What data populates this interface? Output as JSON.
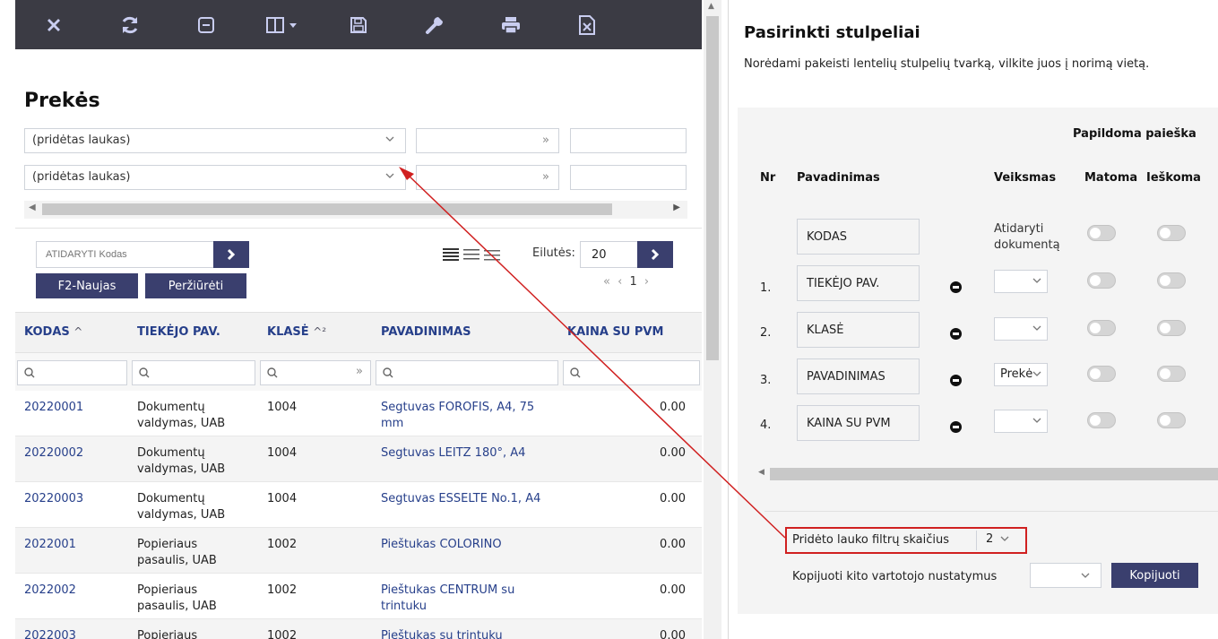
{
  "toolbar": {
    "icons": [
      "close-icon",
      "refresh-icon",
      "collapse-icon",
      "columns-dropdown-icon",
      "save-icon",
      "settings-wrench-icon",
      "print-icon",
      "excel-export-icon"
    ]
  },
  "left": {
    "title": "Prekės",
    "filters": [
      {
        "field": "(pridėtas laukas)",
        "value": ""
      },
      {
        "field": "(pridėtas laukas)",
        "value": ""
      }
    ],
    "open_placeholder": "ATIDARYTI Kodas",
    "btn_new": "F2-Naujas",
    "btn_view": "Peržiūrėti",
    "rows_label": "Eilutės:",
    "rows_value": "20",
    "pager_prev2": "«",
    "pager_prev": "‹",
    "pager_page": "1",
    "pager_next": "›",
    "columns": [
      {
        "label": "KODAS",
        "sort": "^"
      },
      {
        "label": "TIEKĖJO PAV.",
        "sort": ""
      },
      {
        "label": "KLASĖ",
        "sort": "^²"
      },
      {
        "label": "PAVADINIMAS",
        "sort": ""
      },
      {
        "label": "KAINA SU PVM",
        "sort": ""
      }
    ],
    "rows": [
      {
        "kodas": "20220001",
        "tiekejas": "Dokumentų valdymas, UAB",
        "klase": "1004",
        "pavadinimas": "Segtuvas FOROFIS, A4, 75 mm",
        "kaina": "0.00"
      },
      {
        "kodas": "20220002",
        "tiekejas": "Dokumentų valdymas, UAB",
        "klase": "1004",
        "pavadinimas": "Segtuvas LEITZ 180°, A4",
        "kaina": "0.00"
      },
      {
        "kodas": "20220003",
        "tiekejas": "Dokumentų valdymas, UAB",
        "klase": "1004",
        "pavadinimas": "Segtuvas ESSELTE No.1, A4",
        "kaina": "0.00"
      },
      {
        "kodas": "2022001",
        "tiekejas": "Popieriaus pasaulis, UAB",
        "klase": "1002",
        "pavadinimas": "Pieštukas COLORINO",
        "kaina": "0.00"
      },
      {
        "kodas": "2022002",
        "tiekejas": "Popieriaus pasaulis, UAB",
        "klase": "1002",
        "pavadinimas": "Pieštukas CENTRUM su trintuku",
        "kaina": "0.00"
      },
      {
        "kodas": "2022003",
        "tiekejas": "Popieriaus",
        "klase": "1002",
        "pavadinimas": "Pieštukas su trintuku",
        "kaina": "0.00"
      }
    ]
  },
  "right": {
    "title": "Pasirinkti stulpeliai",
    "description": "Norėdami pakeisti lentelių stulpelių tvarką, vilkite juos į norimą vietą.",
    "extra_search_header": "Papildoma paieška",
    "headers": {
      "nr": "Nr",
      "name": "Pavadinimas",
      "action": "Veiksmas",
      "visible": "Matoma",
      "searchable": "Ieškoma"
    },
    "fixed_row": {
      "name": "KODAS",
      "action_line1": "Atidaryti",
      "action_line2": "dokumentą"
    },
    "rows": [
      {
        "nr": "1.",
        "name": "TIEKĖJO PAV.",
        "action": ""
      },
      {
        "nr": "2.",
        "name": "KLASĖ",
        "action": ""
      },
      {
        "nr": "3.",
        "name": "PAVADINIMAS",
        "action": "Prekė"
      },
      {
        "nr": "4.",
        "name": "KAINA SU PVM",
        "action": ""
      }
    ],
    "filter_count_label": "Pridėto lauko filtrų skaičius",
    "filter_count_value": "2",
    "copy_label": "Kopijuoti kito vartotojo nustatymus",
    "copy_value": "",
    "copy_btn": "Kopijuoti"
  },
  "colors": {
    "toolbar_bg": "#3b3b44",
    "accent_btn": "#3a3f6e",
    "link": "#263f8a",
    "highlight_red": "#d02020"
  }
}
